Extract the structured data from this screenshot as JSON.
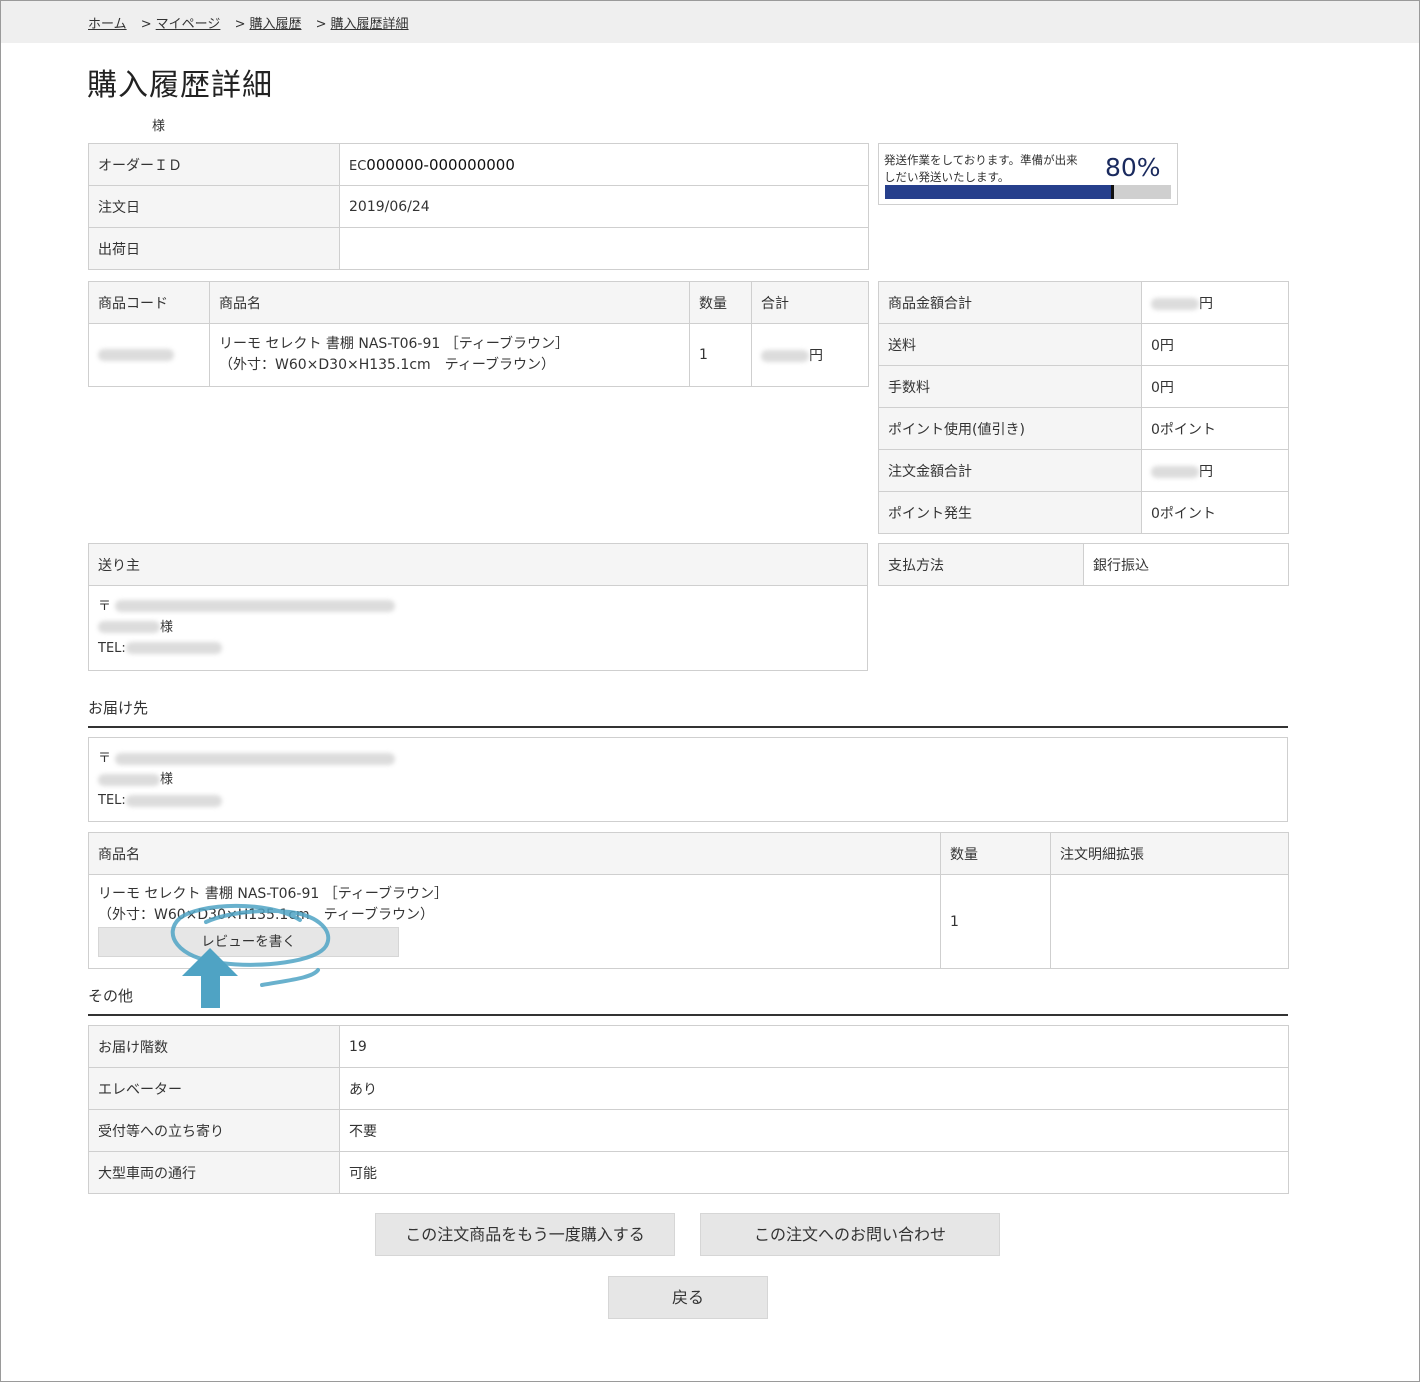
{
  "breadcrumb": {
    "items": [
      "ホーム",
      "マイページ",
      "購入履歴",
      "購入履歴詳細"
    ],
    "separator": ">"
  },
  "page": {
    "title": "購入履歴詳細",
    "honorific": "様"
  },
  "order": {
    "order_id_label": "オーダーＩＤ",
    "order_id_prefix": "EC",
    "order_id_value": "000000-000000000",
    "order_date_label": "注文日",
    "order_date_value": "2019/06/24",
    "ship_date_label": "出荷日",
    "ship_date_value": ""
  },
  "status": {
    "message": "発送作業をしております。準備が出来しだい発送いたします。",
    "percent_text": "80%",
    "progress_fraction": 0.8
  },
  "items_table": {
    "headers": [
      "商品コード",
      "商品名",
      "数量",
      "合計"
    ],
    "rows": [
      {
        "code": "",
        "name_line1": "リーモ セレクト 書棚 NAS-T06-91 ［ティーブラウン］",
        "name_line2": "（外寸：W60×D30×H135.1cm　ティーブラウン）",
        "qty": "1",
        "total_suffix": "円"
      }
    ]
  },
  "totals": {
    "rows": [
      {
        "label": "商品金額合計",
        "value": "円"
      },
      {
        "label": "送料",
        "value": "0円"
      },
      {
        "label": "手数料",
        "value": "0円"
      },
      {
        "label": "ポイント使用(値引き)",
        "value": "0ポイント"
      },
      {
        "label": "注文金額合計",
        "value": "円"
      },
      {
        "label": "ポイント発生",
        "value": "0ポイント"
      }
    ]
  },
  "payment": {
    "label": "支払方法",
    "value": "銀行振込"
  },
  "sender": {
    "heading": "送り主",
    "postal_mark": "〒",
    "name_suffix": "様",
    "tel_label": "TEL:"
  },
  "delivery": {
    "heading": "お届け先",
    "postal_mark": "〒",
    "name_suffix": "様",
    "tel_label": "TEL:"
  },
  "delivery_items": {
    "headers": [
      "商品名",
      "数量",
      "注文明細拡張"
    ],
    "rows": [
      {
        "name_line1": "リーモ セレクト 書棚 NAS-T06-91 ［ティーブラウン］",
        "name_line2": "（外寸：W60×D30×H135.1cm　ティーブラウン）",
        "qty": "1",
        "extension": "",
        "review_button": "レビューを書く"
      }
    ]
  },
  "other": {
    "heading": "その他",
    "rows": [
      {
        "label": "お届け階数",
        "value": "19"
      },
      {
        "label": "エレベーター",
        "value": "あり"
      },
      {
        "label": "受付等への立ち寄り",
        "value": "不要"
      },
      {
        "label": "大型車両の通行",
        "value": "可能"
      }
    ]
  },
  "actions": {
    "rebuy": "この注文商品をもう一度購入する",
    "inquiry": "この注文へのお問い合わせ",
    "back": "戻る"
  },
  "colors": {
    "progress_fill": "#263f8c",
    "annotation": "#4fa3c4",
    "header_bg": "#f5f5f5",
    "button_bg": "#e6e6e6"
  }
}
